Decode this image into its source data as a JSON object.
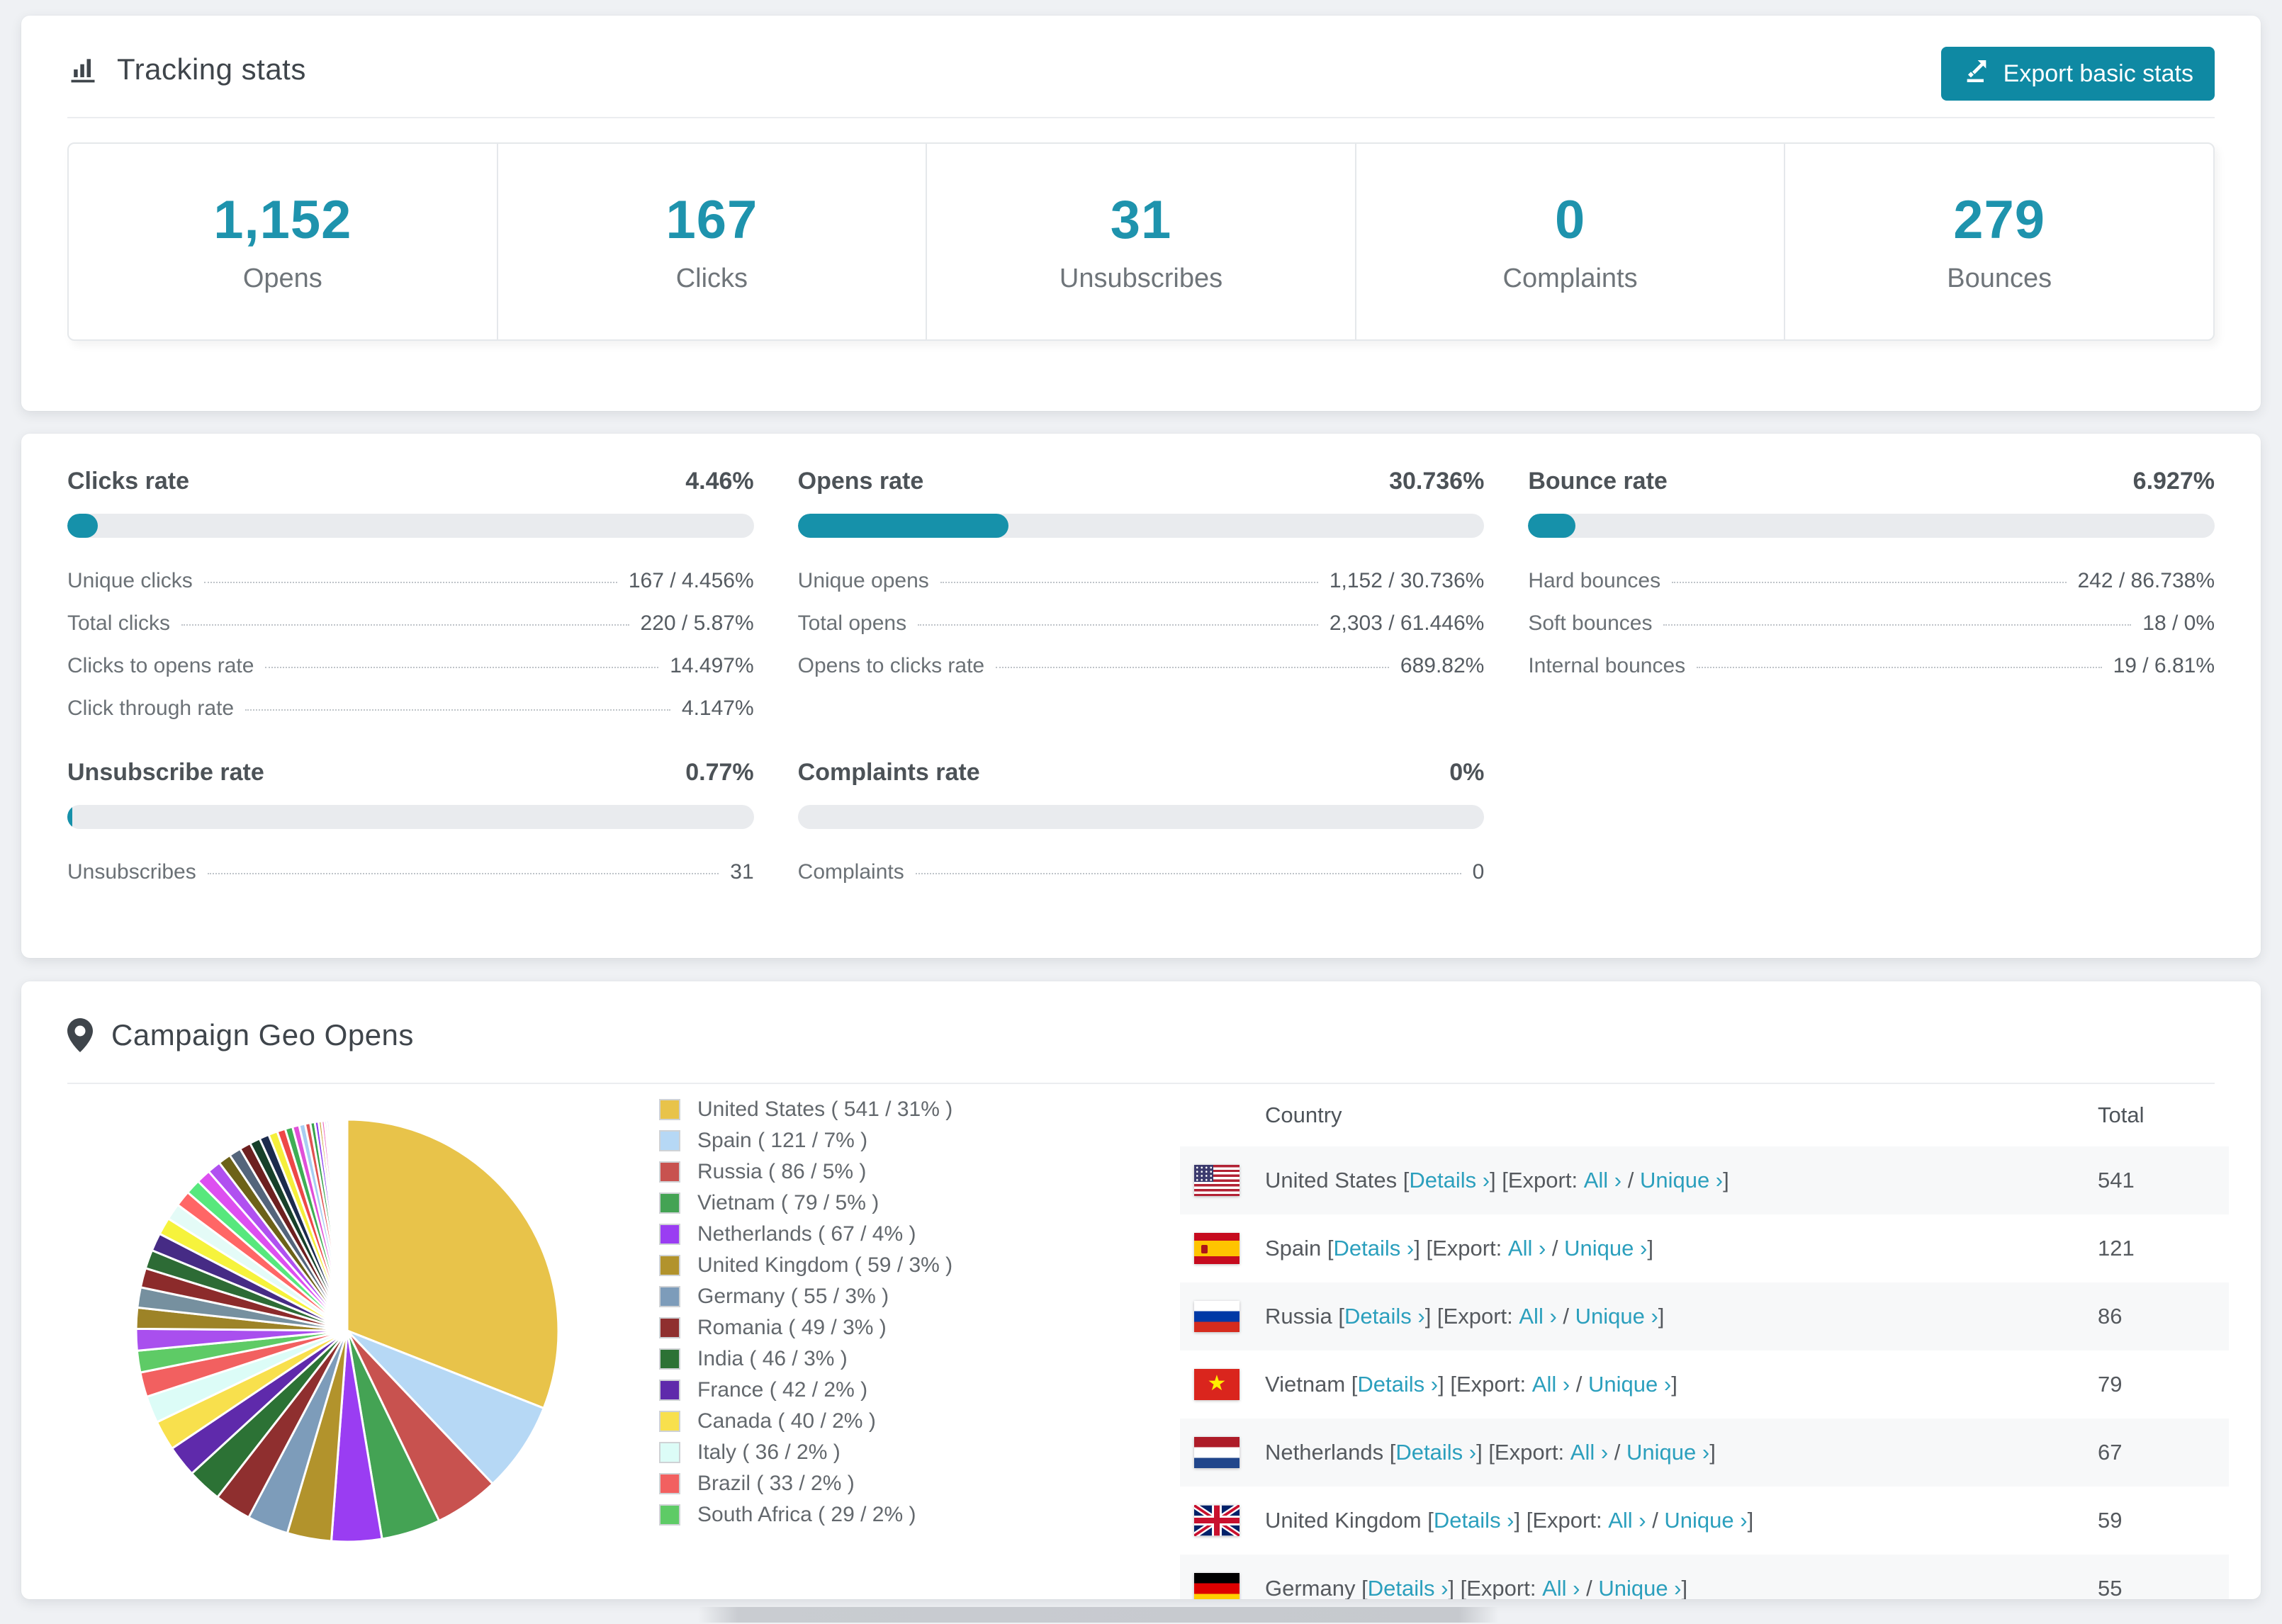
{
  "tracking": {
    "title": "Tracking stats",
    "export_button": "Export basic stats",
    "stats": [
      {
        "value": "1,152",
        "label": "Opens"
      },
      {
        "value": "167",
        "label": "Clicks"
      },
      {
        "value": "31",
        "label": "Unsubscribes"
      },
      {
        "value": "0",
        "label": "Complaints"
      },
      {
        "value": "279",
        "label": "Bounces"
      }
    ]
  },
  "rates": {
    "clicks": {
      "title": "Clicks rate",
      "value": "4.46%",
      "bar_width": "4.46%",
      "rows": [
        {
          "label": "Unique clicks",
          "value": "167 / 4.456%"
        },
        {
          "label": "Total clicks",
          "value": "220 / 5.87%"
        },
        {
          "label": "Clicks to opens rate",
          "value": "14.497%"
        },
        {
          "label": "Click through rate",
          "value": "4.147%"
        }
      ]
    },
    "opens": {
      "title": "Opens rate",
      "value": "30.736%",
      "bar_width": "30.736%",
      "rows": [
        {
          "label": "Unique opens",
          "value": "1,152 / 30.736%"
        },
        {
          "label": "Total opens",
          "value": "2,303 / 61.446%"
        },
        {
          "label": "Opens to clicks rate",
          "value": "689.82%"
        }
      ]
    },
    "bounce": {
      "title": "Bounce rate",
      "value": "6.927%",
      "bar_width": "6.927%",
      "rows": [
        {
          "label": "Hard bounces",
          "value": "242 / 86.738%"
        },
        {
          "label": "Soft bounces",
          "value": "18 / 0%"
        },
        {
          "label": "Internal bounces",
          "value": "19 / 6.81%"
        }
      ]
    },
    "unsubscribe": {
      "title": "Unsubscribe rate",
      "value": "0.77%",
      "bar_width": "0.77%",
      "rows": [
        {
          "label": "Unsubscribes",
          "value": "31"
        }
      ]
    },
    "complaints": {
      "title": "Complaints rate",
      "value": "0%",
      "bar_width": "0%",
      "rows": [
        {
          "label": "Complaints",
          "value": "0"
        }
      ]
    }
  },
  "geo": {
    "title": "Campaign Geo Opens",
    "legend": [
      {
        "text": "United States ( 541 / 31% )",
        "color": "#e8c34a"
      },
      {
        "text": "Spain ( 121 / 7% )",
        "color": "#b6d8f5"
      },
      {
        "text": "Russia ( 86 / 5% )",
        "color": "#c8524f"
      },
      {
        "text": "Vietnam ( 79 / 5% )",
        "color": "#44a354"
      },
      {
        "text": "Netherlands ( 67 / 4% )",
        "color": "#9a3df2"
      },
      {
        "text": "United Kingdom ( 59 / 3% )",
        "color": "#b2932c"
      },
      {
        "text": "Germany ( 55 / 3% )",
        "color": "#7d9cba"
      },
      {
        "text": "Romania ( 49 / 3% )",
        "color": "#8f2f2f"
      },
      {
        "text": "India ( 46 / 3% )",
        "color": "#2c7235"
      },
      {
        "text": "France ( 42 / 2% )",
        "color": "#5f2aab"
      },
      {
        "text": "Canada ( 40 / 2% )",
        "color": "#f8e04d"
      },
      {
        "text": "Italy ( 36 / 2% )",
        "color": "#dcfcf7"
      },
      {
        "text": "Brazil ( 33 / 2% )",
        "color": "#f26060"
      },
      {
        "text": "South Africa ( 29 / 2% )",
        "color": "#5ecb66"
      }
    ],
    "table": {
      "col_country": "Country",
      "col_total": "Total",
      "link_parts": {
        "lp0": " [",
        "details": "Details ›",
        "lp2": "] [Export: ",
        "all": "All ›",
        "lp4": " / ",
        "unique": "Unique ›",
        "lp6": "]"
      },
      "rows": [
        {
          "country": "United States",
          "total": "541"
        },
        {
          "country": "Spain",
          "total": "121"
        },
        {
          "country": "Russia",
          "total": "86"
        },
        {
          "country": "Vietnam",
          "total": "79"
        },
        {
          "country": "Netherlands",
          "total": "67"
        },
        {
          "country": "United Kingdom",
          "total": "59"
        },
        {
          "country": "Germany",
          "total": "55"
        }
      ]
    }
  },
  "chart_data": {
    "type": "pie",
    "title": "Campaign Geo Opens",
    "unit": "opens",
    "legend_position": "right",
    "start_angle_deg": 0,
    "direction": "clockwise",
    "slices": [
      {
        "label": "United States",
        "value": 541,
        "pct": "31%",
        "color": "#e8c34a"
      },
      {
        "label": "Spain",
        "value": 121,
        "pct": "7%",
        "color": "#b6d8f5"
      },
      {
        "label": "Russia",
        "value": 86,
        "pct": "5%",
        "color": "#c8524f"
      },
      {
        "label": "Vietnam",
        "value": 79,
        "pct": "5%",
        "color": "#44a354"
      },
      {
        "label": "Netherlands",
        "value": 67,
        "pct": "4%",
        "color": "#9a3df2"
      },
      {
        "label": "United Kingdom",
        "value": 59,
        "pct": "3%",
        "color": "#b2932c"
      },
      {
        "label": "Germany",
        "value": 55,
        "pct": "3%",
        "color": "#7d9cba"
      },
      {
        "label": "Romania",
        "value": 49,
        "pct": "3%",
        "color": "#8f2f2f"
      },
      {
        "label": "India",
        "value": 46,
        "pct": "3%",
        "color": "#2c7235"
      },
      {
        "label": "France",
        "value": 42,
        "pct": "2%",
        "color": "#5f2aab"
      },
      {
        "label": "Canada",
        "value": 40,
        "pct": "2%",
        "color": "#f8e04d"
      },
      {
        "label": "Italy",
        "value": 36,
        "pct": "2%",
        "color": "#dcfcf7"
      },
      {
        "label": "Brazil",
        "value": 33,
        "pct": "2%",
        "color": "#f26060"
      },
      {
        "label": "South Africa",
        "value": 29,
        "pct": "2%",
        "color": "#5ecb66"
      }
    ],
    "others": {
      "label": "other-countries-small-slices",
      "values": [
        29,
        28,
        27,
        26,
        25,
        24,
        23,
        22,
        21,
        20,
        19,
        18,
        17,
        16,
        15,
        14,
        13,
        12,
        11,
        10,
        9,
        8,
        7,
        6,
        5,
        4,
        4,
        3,
        3,
        2,
        2,
        2,
        2,
        1,
        1,
        1,
        1,
        1,
        1,
        1,
        1,
        1,
        1,
        1,
        1,
        1,
        1,
        1,
        1
      ],
      "colors": [
        "#a94fee",
        "#9d8327",
        "#76909f",
        "#8c2b2b",
        "#2d6b35",
        "#462b85",
        "#f6f33c",
        "#e4fbf7",
        "#ff6666",
        "#57e87d",
        "#dd4ff0",
        "#b050f0",
        "#6d6218",
        "#54657b",
        "#6d2020",
        "#17402a",
        "#1c2b4d",
        "#f5ef3b",
        "#ee4747",
        "#3fae54",
        "#e04fd8",
        "#a8cdf2",
        "#e05252",
        "#37a24c",
        "#8a3bf0",
        "#c9a233",
        "#f06fc0",
        "#6fb1f0",
        "#9b8cf0",
        "#f0a84f",
        "#4fe0d2",
        "#e0e04f",
        "#8c5a2b",
        "#5a8c2b",
        "#2b8c8c",
        "#8c2b5a",
        "#4f6fe0",
        "#e04f6f",
        "#6fe04f",
        "#d2b84f",
        "#b84fd2",
        "#4fd2b8",
        "#a0a0a0",
        "#e8c245",
        "#aed5f2",
        "#c94c4c",
        "#4aa353",
        "#9836f5",
        "#b3952d"
      ]
    }
  },
  "theme": {
    "accent": "#1e93ad",
    "button": "#0f89a3",
    "link": "#2b9fbd",
    "bar_fill": "#1691aa",
    "bar_track": "#e9ebee",
    "row_stripe": "#f7f8f9"
  }
}
